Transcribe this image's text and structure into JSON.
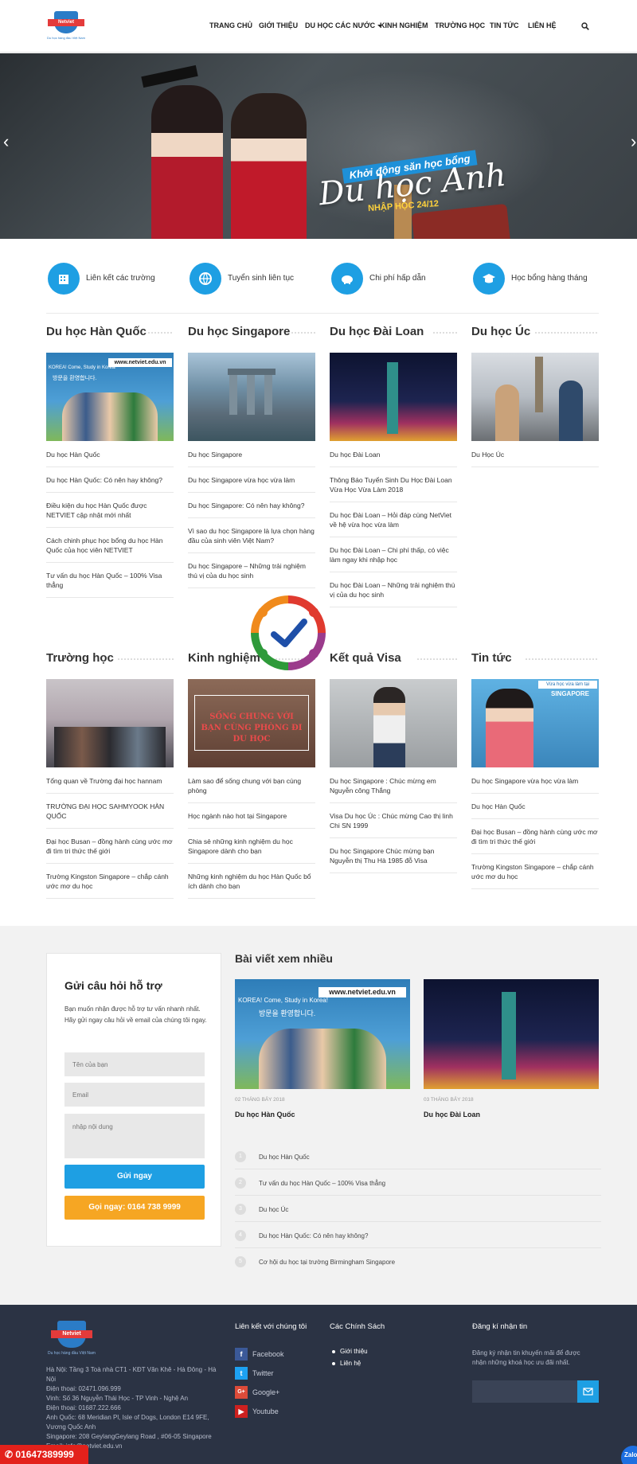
{
  "header": {
    "logo_text": "Netviet",
    "logo_slogan": "Du học hàng đầu Việt Nam",
    "nav": [
      "TRANG CHỦ",
      "GIỚI THIỆU",
      "DU HỌC CÁC NƯỚC",
      "KINH NGHIỆM",
      "TRƯỜNG HỌC",
      "TIN TỨC",
      "LIÊN HỆ"
    ]
  },
  "banner": {
    "tagline": "Khởi động săn học bổng",
    "headline": "Du học Anh",
    "date": "NHẬP HỌC 24/12"
  },
  "features": [
    "Liên kết các trường",
    "Tuyển sinh liên tục",
    "Chi phí hấp dẫn",
    "Học bổng hàng tháng"
  ],
  "sections": [
    {
      "title": "Du học Hàn Quốc",
      "items": [
        "Du học Hàn Quốc",
        "Du học Hàn Quốc: Có nên hay không?",
        "Điều kiện du học Hàn Quốc được NETVIET cập nhật mới nhất",
        "Cách chinh phục học bổng du học Hàn Quốc của học viên NETVIET",
        "Tư vấn du học Hàn Quốc – 100% Visa thẳng"
      ]
    },
    {
      "title": "Du học Singapore",
      "items": [
        "Du học Singapore",
        "Du học Singapore vừa học vừa làm",
        "Du học Singapore: Có nên hay không?",
        "Vì sao du học Singapore là lựa chọn hàng đầu của sinh viên Việt Nam?",
        "Du học Singapore – Những trải nghiệm thú vị của du học sinh"
      ]
    },
    {
      "title": "Du học Đài Loan",
      "items": [
        "Du học Đài Loan",
        "Thông Báo Tuyển Sinh Du Học Đài Loan Vừa Học Vừa Làm 2018",
        "Du học Đài Loan – Hỏi đáp cùng NetViet về hệ vừa học vừa làm",
        "Du học Đài Loan – Chi phí thấp, có việc làm ngay khi nhập học",
        "Du học Đài Loan – Những trải nghiệm thú vị của du học sinh"
      ]
    },
    {
      "title": "Du học Úc",
      "items": [
        "Du Học Úc"
      ]
    },
    {
      "title": "Trường học",
      "items": [
        "Tổng quan về Trường đại học hannam",
        "TRƯỜNG ĐẠI HỌC SAHMYOOK HÀN QUỐC",
        "Đại học Busan – đồng hành cùng ước mơ đi tìm tri thức thế giới",
        "Trường Kingston Singapore – chắp cánh ước mơ du học"
      ]
    },
    {
      "title": "Kinh nghiệm",
      "items": [
        "Làm sao để sống chung với bạn cùng phòng",
        "Học ngành nào hot tại Singapore",
        "Chia sẻ những kinh nghiệm du học Singapore dành cho bạn",
        "Những kinh nghiệm du học Hàn Quốc bổ ích dành cho bạn"
      ]
    },
    {
      "title": "Kết quả Visa",
      "items": [
        "Du học Singapore : Chúc mừng em Nguyễn công Thắng",
        "Visa Du học Úc : Chúc mừng Cao thị linh Chi SN 1999",
        "Du học Singapore Chúc mừng bạn Nguyễn thị Thu Hà 1985 đỗ Visa"
      ]
    },
    {
      "title": "Tin tức",
      "items": [
        "Du học Singapore vừa học vừa làm",
        "Du học Hàn Quốc",
        "Đại học Busan – đồng hành cùng ước mơ đi tìm tri thức thế giới",
        "Trường Kingston Singapore – chắp cánh ước mơ du học"
      ]
    }
  ],
  "thumb_text": {
    "korea_url": "www.netviet.edu.vn",
    "korea_slogan": "KOREA! Come, Study in Korea!",
    "korea_hangul": "방문을 환영합니다.",
    "kinh_nghiem": "SỐNG CHUNG VỚI BẠN CÙNG PHÒNG ĐI DU HỌC",
    "singapore_tag": "Vừa học vừa làm tại",
    "singapore_word": "SINGAPORE"
  },
  "support_form": {
    "title": "Gửi câu hỏi hỗ trợ",
    "desc": "Bạn muốn nhận được hỗ trợ tư vấn nhanh nhất. Hãy gửi ngay câu hỏi về email của chúng tôi ngay.",
    "name_placeholder": "Tên của bạn",
    "email_placeholder": "Email",
    "content_placeholder": "nhập nội dung",
    "send_label": "Gửi ngay",
    "call_label": "Gọi ngay: 0164 738 9999"
  },
  "popular": {
    "title": "Bài viết xem nhiều",
    "cards": [
      {
        "date": "02 THÁNG BẢY 2018",
        "name": "Du học Hàn Quốc"
      },
      {
        "date": "03 THÁNG BẢY 2018",
        "name": "Du học Đài Loan"
      }
    ],
    "ranked": [
      {
        "num": "1",
        "title": "Du học Hàn Quốc"
      },
      {
        "num": "2",
        "title": "Tư vấn du học Hàn Quốc – 100% Visa thẳng"
      },
      {
        "num": "3",
        "title": "Du học Úc"
      },
      {
        "num": "4",
        "title": "Du học Hàn Quốc: Có nên hay không?"
      },
      {
        "num": "5",
        "title": "Cơ hội du học tại trường Birmingham Singapore"
      }
    ]
  },
  "footer": {
    "address_lines": [
      "Hà Nội: Tầng 3 Toà nhà CT1 - KĐT Văn Khê - Hà Đông - Hà Nội",
      "Điện thoại: 02471.096.999",
      "Vinh: Số 36 Nguyễn Thái Học - TP Vinh - Nghệ An",
      "Điện thoại: 01687.222.666",
      "Anh Quốc: 68 Meridian Pl, Isle of Dogs, London E14 9FE, Vương Quốc Anh",
      "Singapore: 208 GeylangGeylang Road , #06-05 Singapore",
      "Email: info@netviet.edu.vn"
    ],
    "social_title": "Liên kết với chúng tôi",
    "social": [
      "Facebook",
      "Twitter",
      "Google+",
      "Youtube"
    ],
    "policy_title": "Các Chính Sách",
    "policies": [
      "Giới thiệu",
      "Liên hệ"
    ],
    "newsletter_title": "Đăng kí nhận tin",
    "newsletter_desc": "Đăng ký nhận tin khuyến mãi để được nhận những khoá học ưu đãi nhất."
  },
  "hotline": "01647389999",
  "zalo": "Zalo",
  "colors": {
    "accent": "#1e9fe3",
    "orange": "#f6a623",
    "footer_bg": "#2b3344",
    "hotline_red": "#e3211b"
  }
}
